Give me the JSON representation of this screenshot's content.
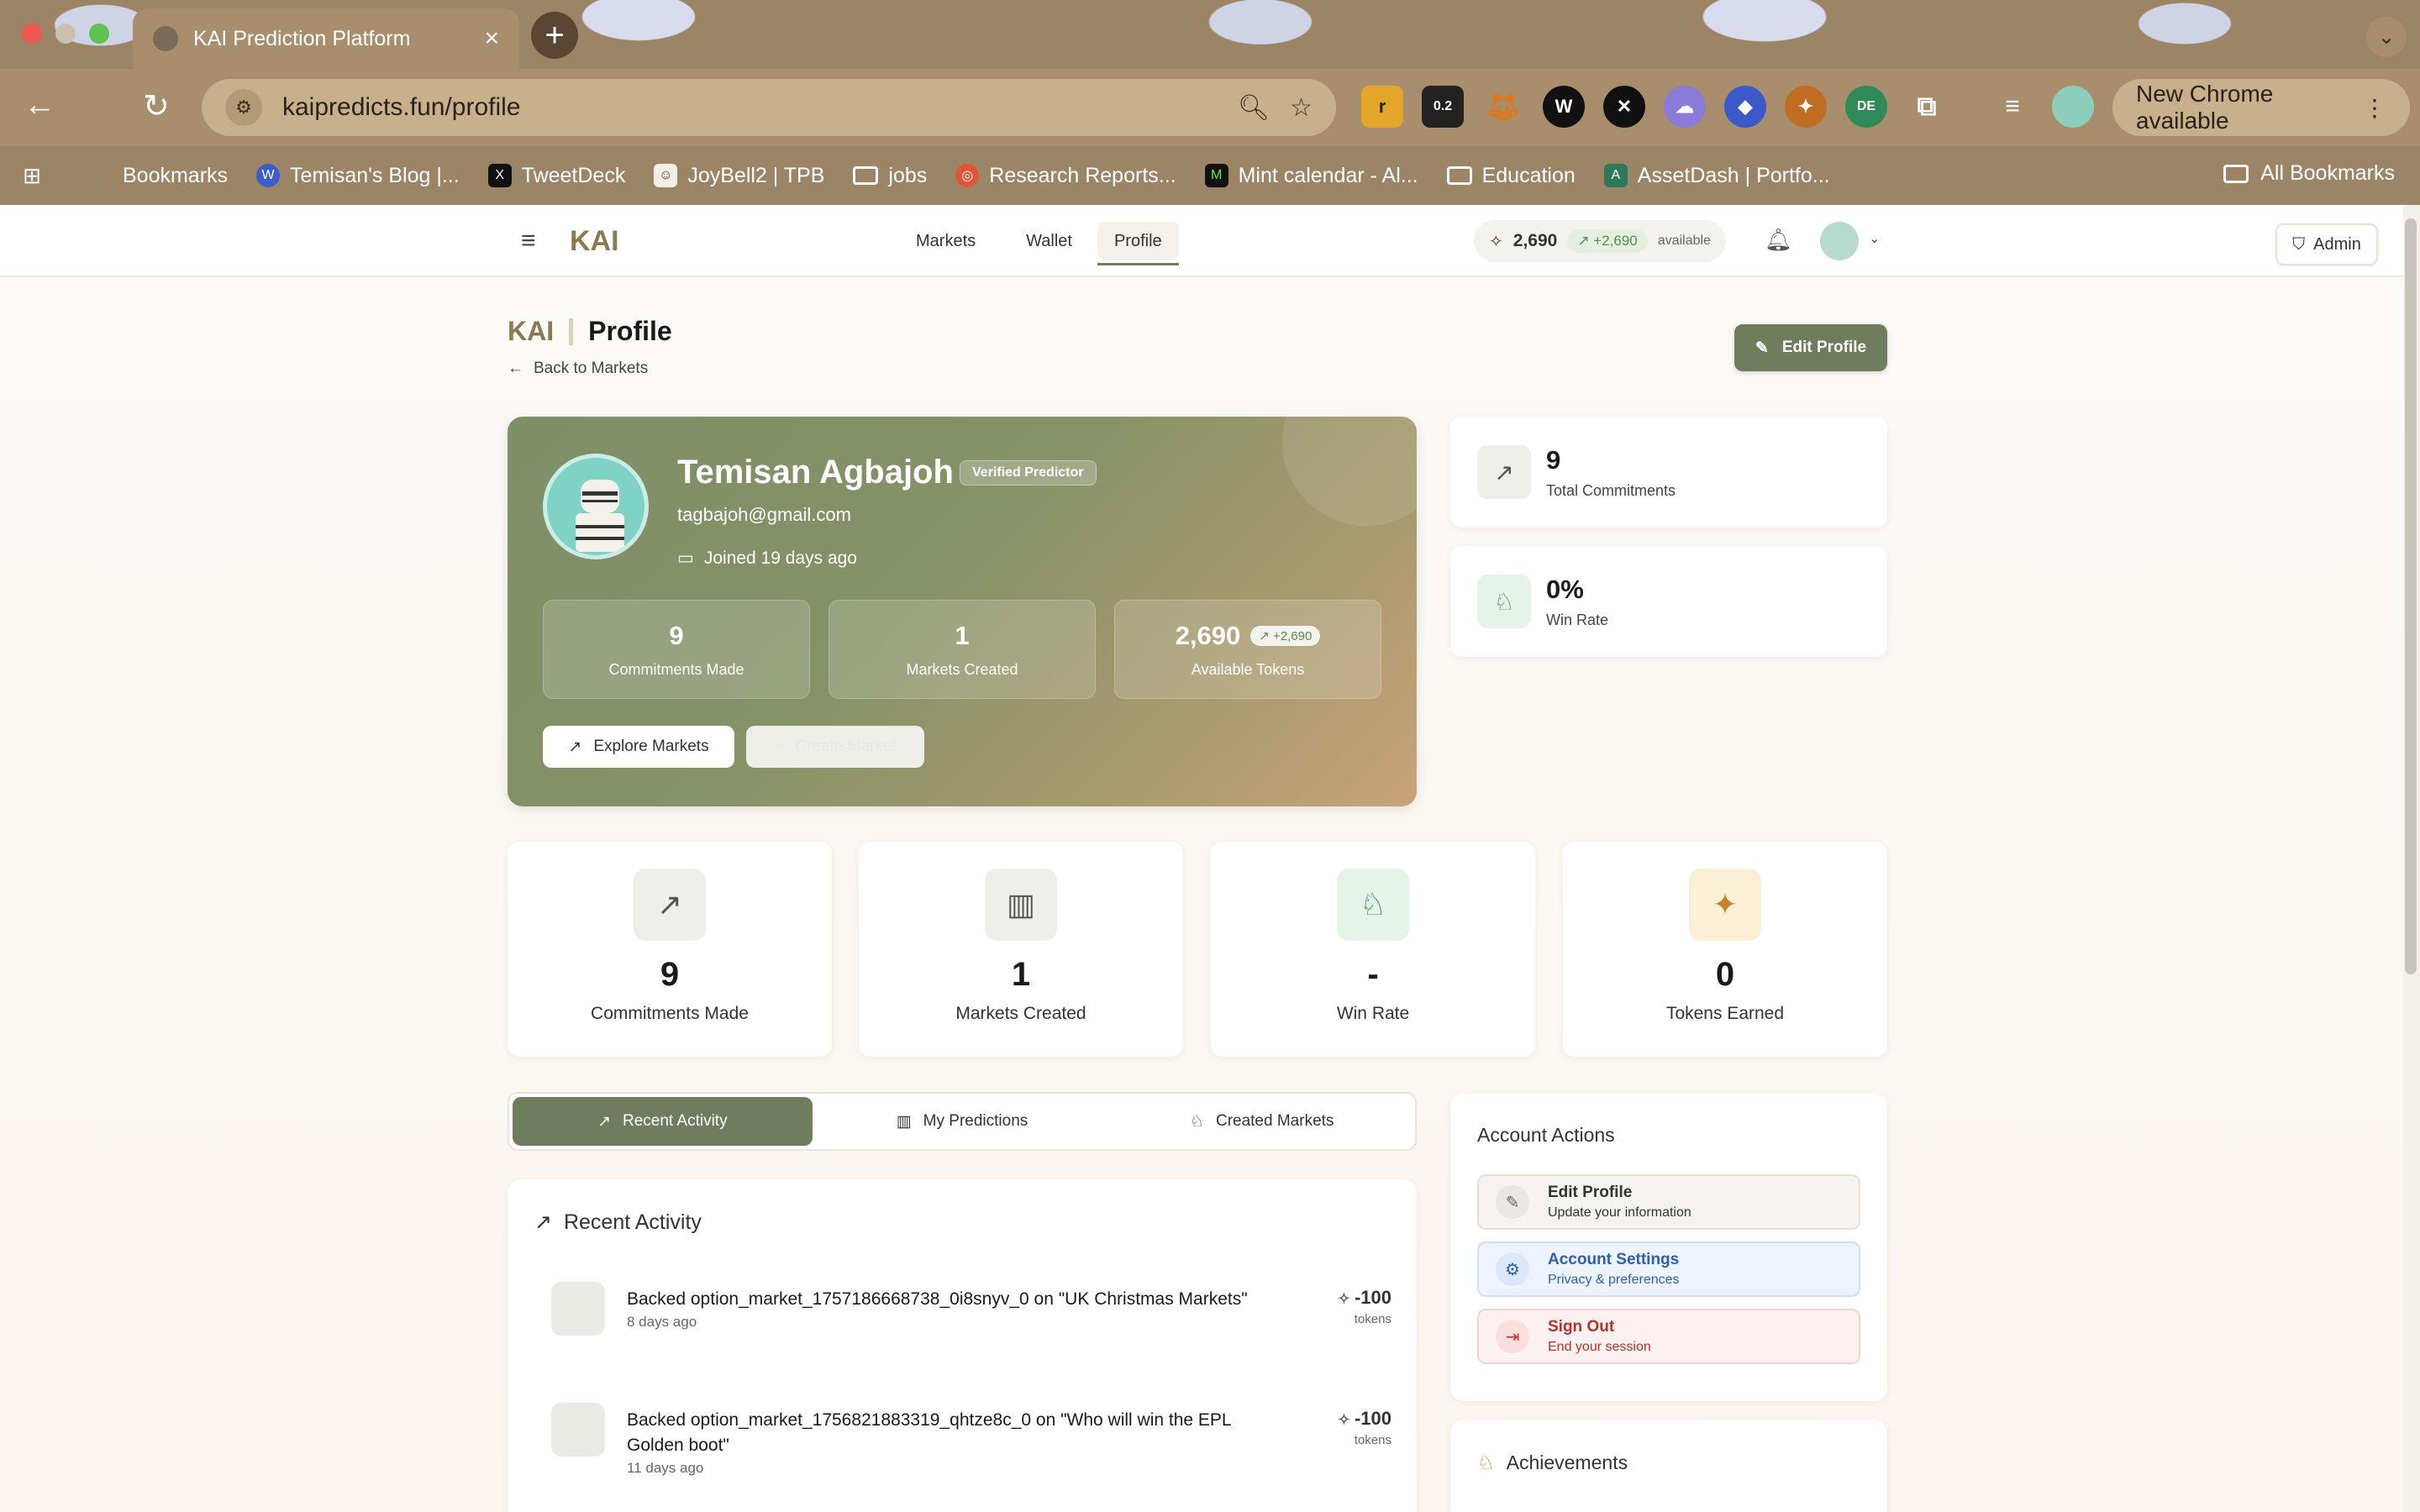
{
  "browser": {
    "tab_title": "KAI Prediction Platform",
    "url": "kaipredicts.fun/profile",
    "chrome_update": "New Chrome available",
    "extensions": [
      "r",
      "0.2",
      "DE"
    ],
    "bookmarks": [
      "Bookmarks",
      "Temisan's Blog |...",
      "TweetDeck",
      "JoyBell2 | TPB",
      "jobs",
      "Research Reports...",
      "Mint calendar - Al...",
      "Education",
      "AssetDash | Portfo..."
    ],
    "all_bookmarks": "All Bookmarks"
  },
  "appbar": {
    "brand": "KAI",
    "nav": [
      "Markets",
      "Wallet",
      "Profile"
    ],
    "active_nav": "Profile",
    "balance": "2,690",
    "balance_change": "+2,690",
    "balance_suffix": "available",
    "admin_label": "Admin"
  },
  "header": {
    "brand": "KAI",
    "title": "Profile",
    "back_label": "Back to Markets",
    "edit_button": "Edit Profile"
  },
  "profile": {
    "name": "Temisan Agbajoh",
    "badge": "Verified Predictor",
    "email": "tagbajoh@gmail.com",
    "joined": "Joined 19 days ago",
    "stats": [
      {
        "value": "9",
        "label": "Commitments Made"
      },
      {
        "value": "1",
        "label": "Markets Created"
      },
      {
        "value": "2,690",
        "change": "+2,690",
        "label": "Available Tokens"
      }
    ],
    "explore_button": "Explore Markets",
    "create_button": "Create Market"
  },
  "summary": [
    {
      "value": "9",
      "label": "Total Commitments"
    },
    {
      "value": "0%",
      "label": "Win Rate"
    }
  ],
  "stat_cards": [
    {
      "value": "9",
      "label": "Commitments Made"
    },
    {
      "value": "1",
      "label": "Markets Created"
    },
    {
      "value": "-",
      "label": "Win Rate"
    },
    {
      "value": "0",
      "label": "Tokens Earned"
    }
  ],
  "tabs": [
    "Recent Activity",
    "My Predictions",
    "Created Markets"
  ],
  "activity": {
    "title": "Recent Activity",
    "items": [
      {
        "text": "Backed option_market_1757186668738_0i8snyv_0 on \"UK Christmas Markets\"",
        "time": "8 days ago",
        "amount": "-100",
        "unit": "tokens"
      },
      {
        "text": "Backed option_market_1756821883319_qhtze8c_0 on \"Who will win the EPL Golden boot\"",
        "time": "11 days ago",
        "amount": "-100",
        "unit": "tokens"
      }
    ]
  },
  "account_actions": {
    "title": "Account Actions",
    "items": [
      {
        "title": "Edit Profile",
        "subtitle": "Update your information"
      },
      {
        "title": "Account Settings",
        "subtitle": "Privacy & preferences"
      },
      {
        "title": "Sign Out",
        "subtitle": "End your session"
      }
    ]
  },
  "achievements": {
    "title": "Achievements"
  },
  "colors": {
    "primary": "#6f7d5c",
    "brand": "#8a7a4f",
    "positive": "#5a8a4d",
    "danger": "#c0392b",
    "info": "#2f5fb3"
  }
}
